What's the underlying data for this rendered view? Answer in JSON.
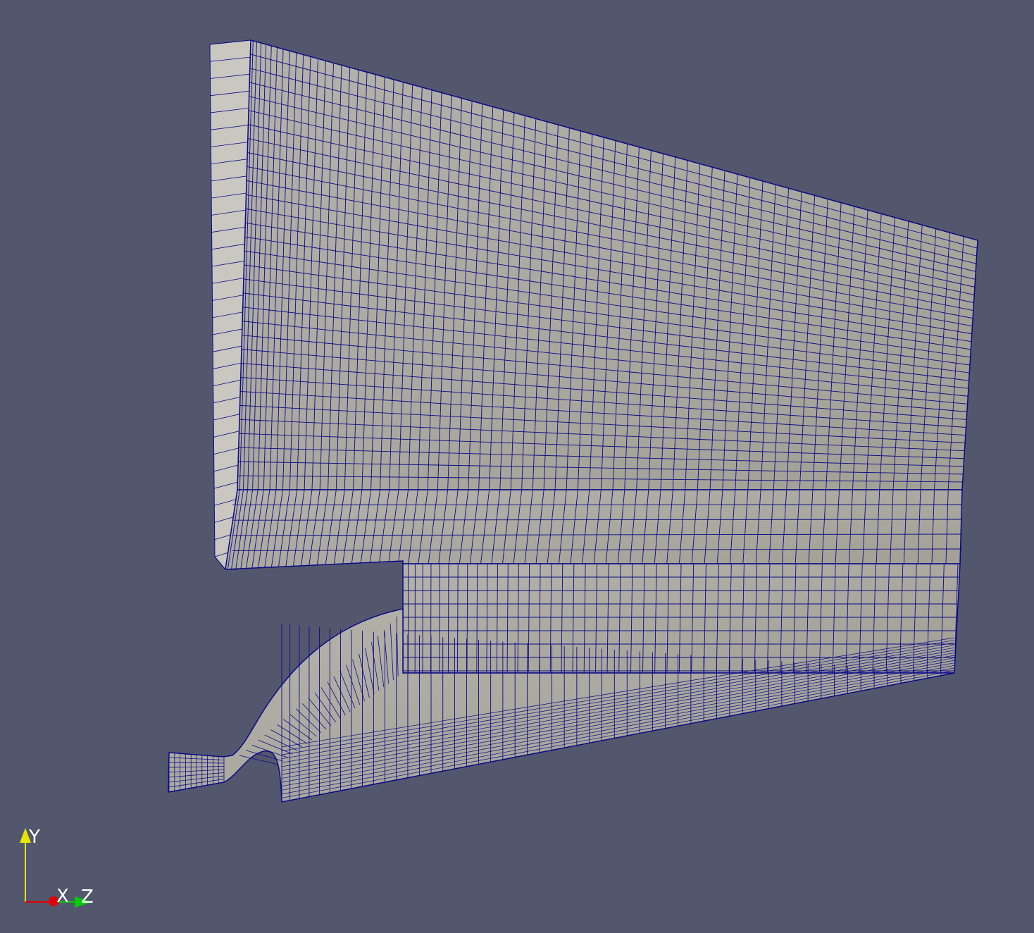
{
  "scene": {
    "background_color": "#52576e",
    "surface_color": "#a7a49a",
    "surface_light_color": "#b8b6ae",
    "wireframe_color": "#0b0b86"
  },
  "orientation_axes": {
    "y_label": "Y",
    "x_label": "X",
    "z_label": "Z",
    "y_color": "#e6e600",
    "x_color": "#e00000",
    "z_color": "#00cc00"
  }
}
